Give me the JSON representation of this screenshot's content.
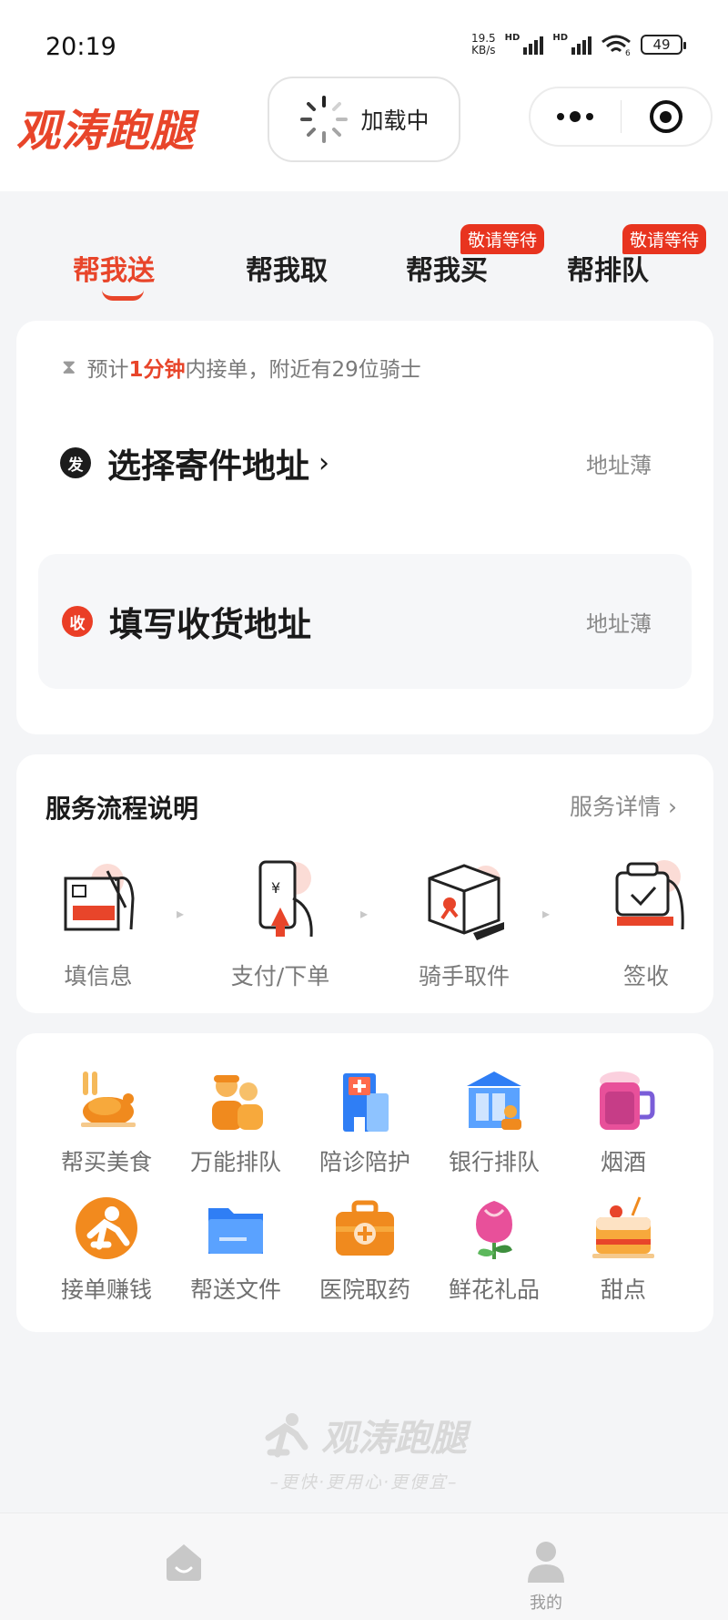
{
  "status_bar": {
    "time": "20:19",
    "net_speed_value": "19.5",
    "net_speed_unit": "KB/s",
    "hd1": "HD",
    "hd2": "HD",
    "wifi_sub": "6",
    "battery": "49"
  },
  "header": {
    "logo": "观涛跑腿",
    "loading_label": "加载中",
    "menu_icon": "more-dots-icon",
    "close_icon": "target-circle-icon"
  },
  "tabs": [
    {
      "label": "帮我送",
      "active": true
    },
    {
      "label": "帮我取"
    },
    {
      "label": "帮我买",
      "badge": "敬请等待"
    },
    {
      "label": "帮排队",
      "badge": "敬请等待"
    }
  ],
  "eta": {
    "prefix": "预计",
    "highlight": "1分钟",
    "suffix": "内接单，附近有29位骑士"
  },
  "sender": {
    "chip": "发",
    "title": "选择寄件地址",
    "arrow": "›",
    "book": "地址薄"
  },
  "receiver": {
    "chip": "收",
    "title": "填写收货地址",
    "book": "地址薄"
  },
  "flow": {
    "title": "服务流程说明",
    "detail": "服务详情 ›",
    "steps": [
      "填信息",
      "支付/下单",
      "骑手取件",
      "签收"
    ]
  },
  "services": [
    {
      "label": "帮买美食",
      "icon": "roast-chicken-icon"
    },
    {
      "label": "万能排队",
      "icon": "people-queue-icon"
    },
    {
      "label": "陪诊陪护",
      "icon": "hospital-building-icon"
    },
    {
      "label": "银行排队",
      "icon": "bank-icon"
    },
    {
      "label": "烟酒",
      "icon": "beer-mug-icon"
    },
    {
      "label": "接单赚钱",
      "icon": "runner-badge-icon"
    },
    {
      "label": "帮送文件",
      "icon": "folder-icon"
    },
    {
      "label": "医院取药",
      "icon": "medical-kit-icon"
    },
    {
      "label": "鲜花礼品",
      "icon": "flower-icon"
    },
    {
      "label": "甜点",
      "icon": "cake-icon"
    }
  ],
  "footer": {
    "brand": "观涛跑腿",
    "slogan": "–更快·更用心·更便宜–"
  },
  "tabbar": {
    "home_icon": "home-icon",
    "mine_label": "我的"
  },
  "colors": {
    "accent": "#e8452a",
    "background": "#f4f5f7",
    "text": "#1f1f1f"
  }
}
